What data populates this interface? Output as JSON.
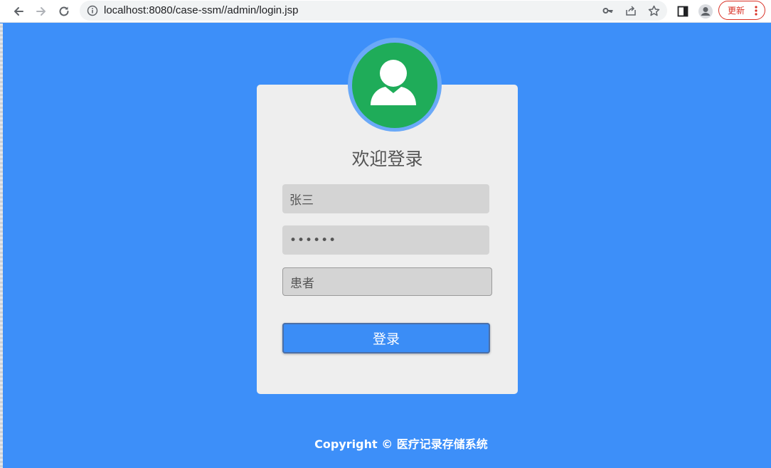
{
  "browser": {
    "url": "localhost:8080/case-ssm//admin/login.jsp",
    "update_label": "更新",
    "icons": [
      "back-icon",
      "forward-icon",
      "reload-icon",
      "info-icon",
      "key-icon",
      "share-icon",
      "star-icon",
      "side-panel-icon",
      "profile-icon",
      "menu-dots-icon"
    ]
  },
  "login": {
    "title": "欢迎登录",
    "username_value": "张三",
    "password_value": "••••••",
    "role_value": "患者",
    "submit_label": "登录"
  },
  "footer": {
    "copyright": "Copyright © 医疗记录存储系统"
  },
  "colors": {
    "page_bg": "#3d8ff9",
    "card_bg": "#eeeeee",
    "avatar_bg": "#1fac59",
    "button_bg": "#3b8df6",
    "input_bg": "#d4d4d4"
  }
}
